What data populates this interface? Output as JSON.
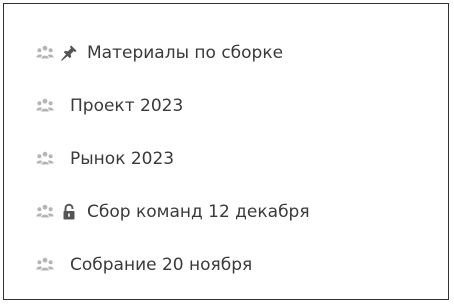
{
  "colors": {
    "text": "#3a3a3a",
    "group_icon": "#b5b5b5",
    "pin_icon": "#555555",
    "lock_icon": "#555555",
    "border": "#333333"
  },
  "items": [
    {
      "label": "Материалы по сборке",
      "group_icon": "group-icon",
      "extra_icon": "pin-icon"
    },
    {
      "label": "Проект 2023",
      "group_icon": "group-icon",
      "extra_icon": ""
    },
    {
      "label": "Рынок 2023",
      "group_icon": "group-icon",
      "extra_icon": ""
    },
    {
      "label": "Сбор команд 12 декабря",
      "group_icon": "group-icon",
      "extra_icon": "lock-icon"
    },
    {
      "label": "Собрание 20 ноября",
      "group_icon": "group-icon",
      "extra_icon": ""
    }
  ]
}
